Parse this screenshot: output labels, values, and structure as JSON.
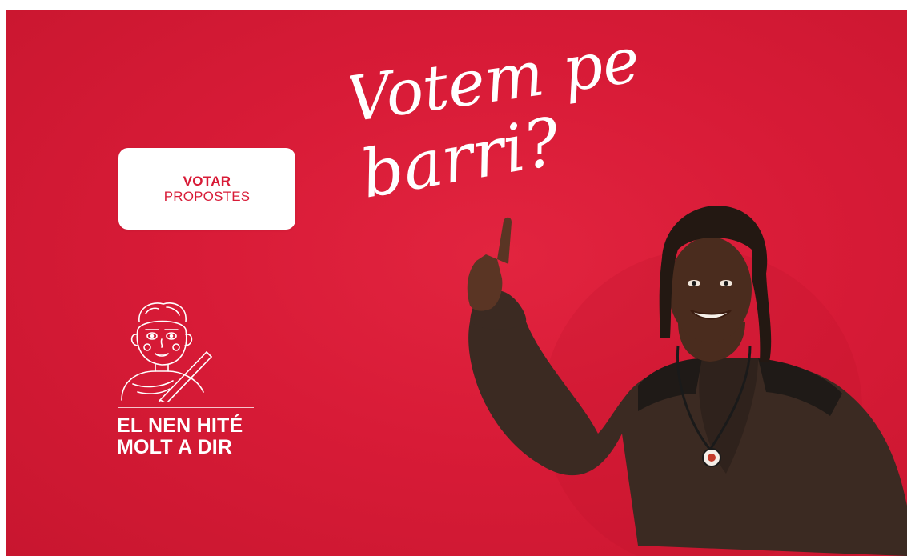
{
  "banner": {
    "background_color": "#d81b37",
    "headline": {
      "line1": "Votem pel",
      "line2": "barri?"
    },
    "vote_button": {
      "line1": "VOTAR",
      "line2": "PROPOSTES"
    },
    "character_icon": "child-character-with-pencil-icon",
    "tagline": {
      "line1": "EL NEN HITÉ",
      "line2": "MOLT A DIR"
    },
    "photo": "smiling-man-pointing-up"
  }
}
